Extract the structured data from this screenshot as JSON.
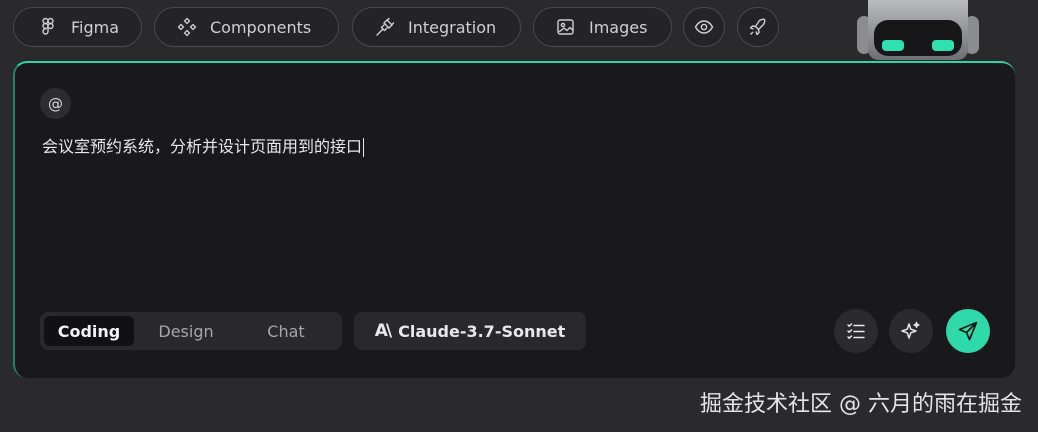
{
  "top_bar": {
    "pills": [
      {
        "label": "Figma",
        "icon": "figma-icon"
      },
      {
        "label": "Components",
        "icon": "components-icon"
      },
      {
        "label": "Integration",
        "icon": "plug-icon"
      },
      {
        "label": "Images",
        "icon": "image-icon"
      }
    ],
    "eye_icon": "eye-icon",
    "rocket_icon": "rocket-icon"
  },
  "panel": {
    "mention_symbol": "@",
    "prompt_text": "会议室预约系统，分析并设计页面用到的接口",
    "modes": [
      "Coding",
      "Design",
      "Chat"
    ],
    "active_mode": "Coding",
    "model_logo": "A\\",
    "model_name": "Claude-3.7-Sonnet",
    "actions": [
      "list-icon",
      "sparkle-icon",
      "send-icon"
    ]
  },
  "colors": {
    "accent": "#2fd9a9",
    "panel_bg": "#19191b",
    "page_bg": "#2a2a2c"
  },
  "watermark": "掘金技术社区 @ 六月的雨在掘金"
}
